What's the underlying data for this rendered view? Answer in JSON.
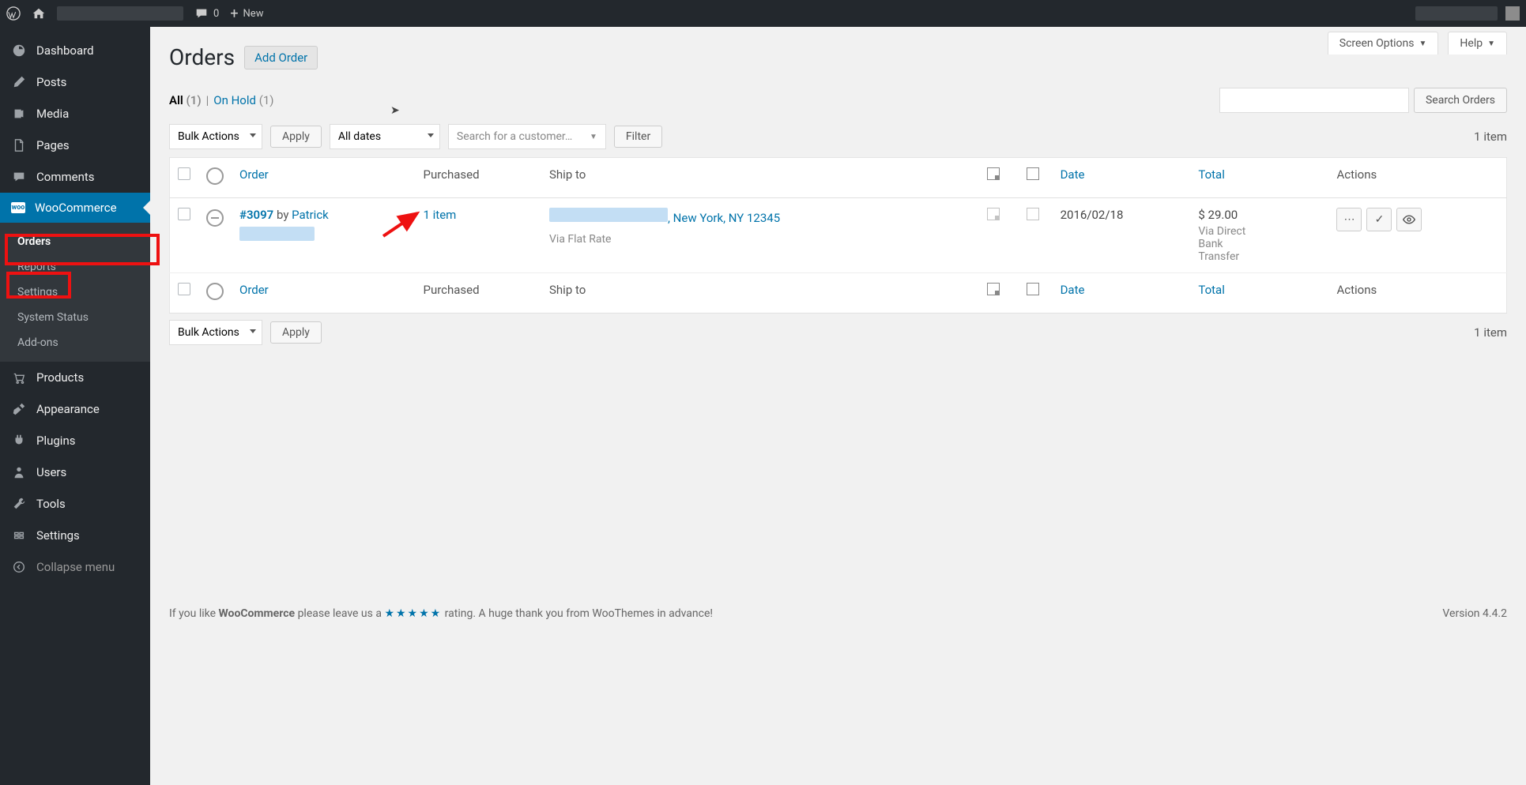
{
  "adminbar": {
    "comments_count": "0",
    "new_label": "New"
  },
  "sidebar": {
    "items": [
      {
        "label": "Dashboard"
      },
      {
        "label": "Posts"
      },
      {
        "label": "Media"
      },
      {
        "label": "Pages"
      },
      {
        "label": "Comments"
      },
      {
        "label": "WooCommerce"
      },
      {
        "label": "Products"
      },
      {
        "label": "Appearance"
      },
      {
        "label": "Plugins"
      },
      {
        "label": "Users"
      },
      {
        "label": "Tools"
      },
      {
        "label": "Settings"
      }
    ],
    "woo_submenu": [
      {
        "label": "Orders"
      },
      {
        "label": "Reports"
      },
      {
        "label": "Settings"
      },
      {
        "label": "System Status"
      },
      {
        "label": "Add-ons"
      }
    ],
    "collapse": "Collapse menu"
  },
  "screen_tabs": {
    "options": "Screen Options",
    "help": "Help"
  },
  "page": {
    "title": "Orders",
    "add_order": "Add Order"
  },
  "filters": {
    "all_label": "All",
    "all_count": "(1)",
    "onhold_label": "On Hold",
    "onhold_count": "(1)",
    "search_btn": "Search Orders",
    "bulk": "Bulk Actions",
    "apply": "Apply",
    "dates": "All dates",
    "customer_ph": "Search for a customer…",
    "filter_btn": "Filter",
    "item_count": "1 item"
  },
  "table": {
    "headers": {
      "order": "Order",
      "purchased": "Purchased",
      "shipto": "Ship to",
      "date": "Date",
      "total": "Total",
      "actions": "Actions"
    },
    "row": {
      "order_num": "#3097",
      "by": " by ",
      "customer": "Patrick",
      "purchased": "1 item",
      "ship_suffix": ", New York, NY 12345",
      "ship_method": "Via Flat Rate",
      "date": "2016/02/18",
      "total": "$ 29.00",
      "payment": "Via Direct Bank Transfer"
    }
  },
  "footer": {
    "pre": "If you like ",
    "wc": "WooCommerce",
    "mid": " please leave us a ",
    "stars": "★★★★★",
    "post": " rating. A huge thank you from WooThemes in advance!",
    "version": "Version 4.4.2"
  }
}
